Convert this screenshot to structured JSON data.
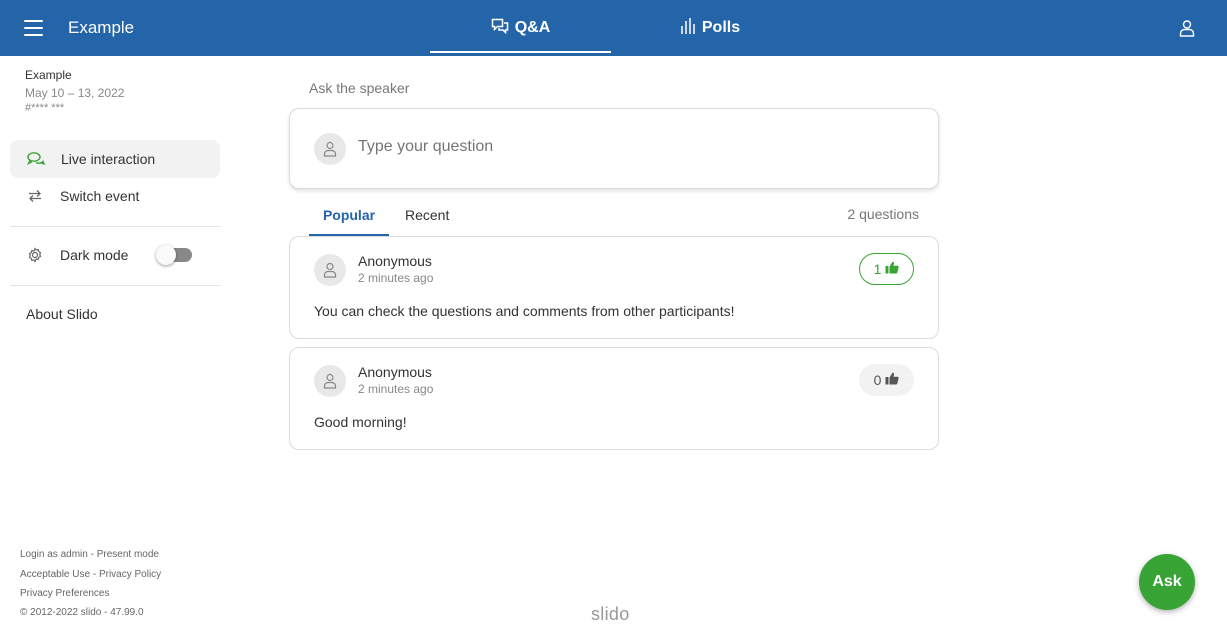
{
  "header": {
    "title": "Example",
    "tabs": [
      {
        "label": "Q&A",
        "icon": "chat-bubbles-icon",
        "active": true
      },
      {
        "label": "Polls",
        "icon": "bar-chart-icon",
        "active": false
      }
    ]
  },
  "sidebar": {
    "event_name": "Example",
    "event_dates": "May 10 – 13, 2022",
    "event_code": "#**** ***",
    "items": [
      {
        "label": "Live interaction",
        "icon": "chat-bubbles-icon",
        "active": true
      },
      {
        "label": "Switch event",
        "icon": "switch-arrows-icon",
        "active": false
      }
    ],
    "dark_mode_label": "Dark mode",
    "dark_mode_enabled": false,
    "about_label": "About Slido",
    "footer": {
      "login_admin": "Login as admin",
      "present_mode": "Present mode",
      "acceptable_use": "Acceptable Use",
      "privacy_policy": "Privacy Policy",
      "privacy_preferences": "Privacy Preferences",
      "copyright": "© 2012-2022 slido - 47.99.0"
    }
  },
  "main": {
    "ask_label": "Ask the speaker",
    "ask_placeholder": "Type your question",
    "tabs": [
      {
        "label": "Popular",
        "active": true
      },
      {
        "label": "Recent",
        "active": false
      }
    ],
    "question_count": "2 questions",
    "questions": [
      {
        "author": "Anonymous",
        "time": "2 minutes ago",
        "text": "You can check the questions and comments from other participants!",
        "likes": "1",
        "liked": true
      },
      {
        "author": "Anonymous",
        "time": "2 minutes ago",
        "text": "Good morning!",
        "likes": "0",
        "liked": false
      }
    ]
  },
  "ask_button_label": "Ask",
  "brand": "slido",
  "colors": {
    "primary": "#2365a8",
    "accent_green": "#37a435"
  }
}
